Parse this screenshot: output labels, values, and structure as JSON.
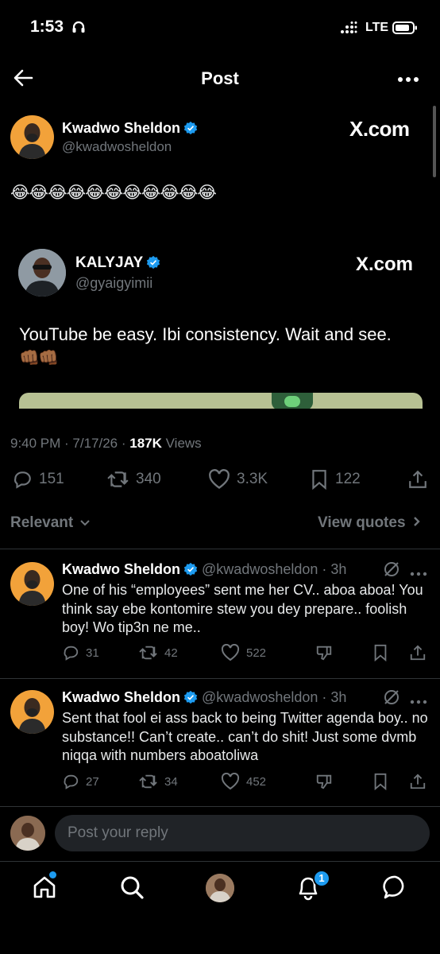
{
  "status_bar": {
    "time": "1:53",
    "network": "LTE"
  },
  "header": {
    "title": "Post"
  },
  "post": {
    "author_name": "Kwadwo Sheldon",
    "author_handle": "@kwadwosheldon",
    "source_logo": "X.com",
    "text": "😂😂😂😂😂😂😂😂😂😂😂",
    "quoted": {
      "author_name": "KALYJAY",
      "author_handle": "@gyaigyimii",
      "source_logo": "X.com",
      "text": "YouTube be easy. Ibi consistency. Wait and see.",
      "emoji": "👊🏾👊🏾"
    },
    "meta": {
      "time": "9:40 PM",
      "date": "7/17/26",
      "views_count": "187K",
      "views_label": "Views"
    },
    "actions": {
      "replies": "151",
      "reposts": "340",
      "likes": "3.3K",
      "bookmarks": "122"
    }
  },
  "filters": {
    "sort_label": "Relevant",
    "view_quotes_label": "View quotes"
  },
  "replies": [
    {
      "author_name": "Kwadwo Sheldon",
      "author_handle": "@kwadwosheldon",
      "age": "3h",
      "text": "One of his “employees” sent me her CV.. aboa aboa! You think say ebe kontomire stew you dey prepare.. foolish boy! Wo tip3n ne me..",
      "replies": "31",
      "reposts": "42",
      "likes": "522"
    },
    {
      "author_name": "Kwadwo Sheldon",
      "author_handle": "@kwadwosheldon",
      "age": "3h",
      "text": "Sent that fool ei ass back to being Twitter agenda boy.. no substance!! Can’t create.. can’t do shit! Just some dvmb niqqa with numbers aboatoliwa",
      "replies": "27",
      "reposts": "34",
      "likes": "452"
    }
  ],
  "composer": {
    "placeholder": "Post your reply"
  },
  "bottom_nav": {
    "notification_count": "1"
  },
  "colors": {
    "background": "#000000",
    "accent": "#1d9bf0",
    "muted": "#71767b",
    "divider": "#2f3336"
  }
}
